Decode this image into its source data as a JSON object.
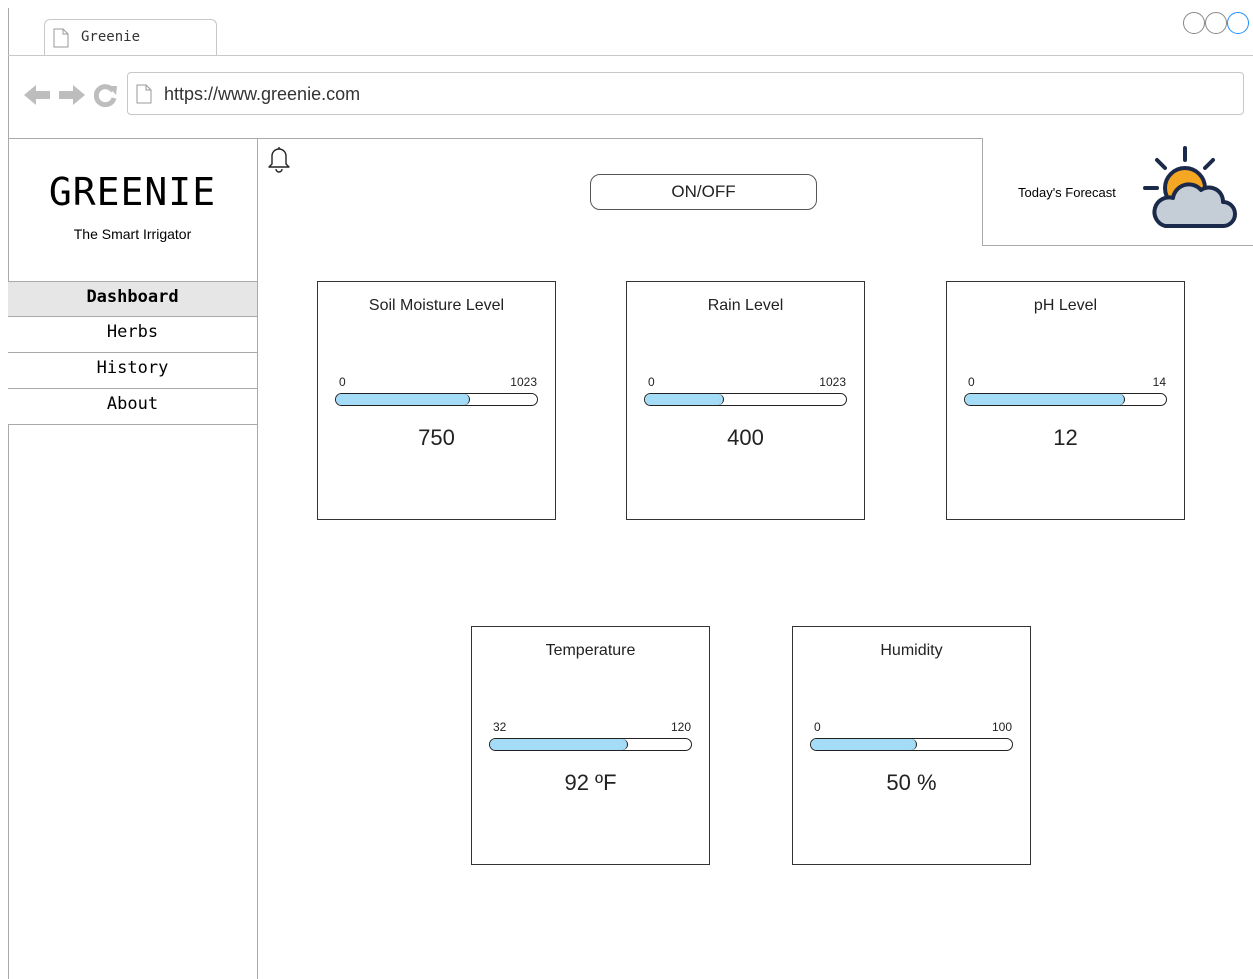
{
  "browser": {
    "tab_title": "Greenie",
    "url": "https://www.greenie.com"
  },
  "sidebar": {
    "logo": "GREENIE",
    "tagline": "The Smart Irrigator",
    "items": [
      {
        "label": "Dashboard",
        "active": true
      },
      {
        "label": "Herbs",
        "active": false
      },
      {
        "label": "History",
        "active": false
      },
      {
        "label": "About",
        "active": false
      }
    ]
  },
  "header": {
    "power_button": "ON/OFF",
    "forecast_label": "Today's Forecast",
    "forecast_icon": "sun-behind-cloud-icon"
  },
  "cards": [
    {
      "title": "Soil Moisture Level",
      "min": "0",
      "max": "1023",
      "value": "750",
      "fill_fraction": 0.66
    },
    {
      "title": "Rain Level",
      "min": "0",
      "max": "1023",
      "value": "400",
      "fill_fraction": 0.39
    },
    {
      "title": "pH Level",
      "min": "0",
      "max": "14",
      "value": "12",
      "fill_fraction": 0.79
    },
    {
      "title": "Temperature",
      "min": "32",
      "max": "120",
      "value": "92 ºF",
      "fill_fraction": 0.68
    },
    {
      "title": "Humidity",
      "min": "0",
      "max": "100",
      "value": "50 %",
      "fill_fraction": 0.52
    }
  ],
  "colors": {
    "bar_fill": "#a4dcf7",
    "active_nav_bg": "#e6e6e6",
    "sun": "#f5a623",
    "cloud": "#c5cdd6",
    "icon_outline": "#1b2a4a"
  }
}
